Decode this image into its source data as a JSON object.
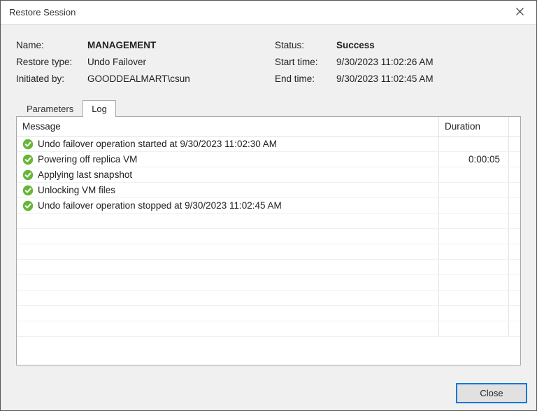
{
  "window": {
    "title": "Restore Session"
  },
  "info": {
    "labels": {
      "name": "Name:",
      "restore_type": "Restore type:",
      "initiated_by": "Initiated by:",
      "status": "Status:",
      "start_time": "Start time:",
      "end_time": "End time:"
    },
    "values": {
      "name": "MANAGEMENT",
      "restore_type": "Undo Failover",
      "initiated_by": "GOODDEALMART\\csun",
      "status": "Success",
      "start_time": "9/30/2023 11:02:26 AM",
      "end_time": "9/30/2023 11:02:45 AM"
    }
  },
  "tabs": {
    "parameters": "Parameters",
    "log": "Log",
    "active": "Log"
  },
  "log": {
    "columns": {
      "message": "Message",
      "duration": "Duration"
    },
    "rows": [
      {
        "status": "success",
        "message": "Undo failover operation started at 9/30/2023 11:02:30 AM",
        "duration": ""
      },
      {
        "status": "success",
        "message": "Powering off replica VM",
        "duration": "0:00:05"
      },
      {
        "status": "success",
        "message": "Applying last snapshot",
        "duration": ""
      },
      {
        "status": "success",
        "message": "Unlocking VM files",
        "duration": ""
      },
      {
        "status": "success",
        "message": "Undo failover operation stopped at 9/30/2023 11:02:45 AM",
        "duration": ""
      }
    ],
    "blank_rows": 8
  },
  "footer": {
    "close": "Close"
  },
  "colors": {
    "success_icon": "#67b637"
  }
}
